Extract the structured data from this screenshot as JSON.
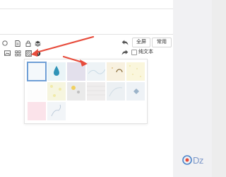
{
  "toolbar": {
    "buttons": {
      "fullscreen": "全屏",
      "common": "常用"
    },
    "plain_text_label": "纯文本",
    "icons": [
      "emoji-icon",
      "document-icon",
      "lock-icon",
      "layers-icon",
      "image-icon",
      "grid-icon",
      "pattern-icon",
      "globe-icon",
      "undo-icon",
      "redo-icon"
    ]
  },
  "background_picker": {
    "swatch_colors": [
      "#f4f8fb",
      "#eaf4f7",
      "#e3e0ec",
      "#eef3f6",
      "#f8f1e0",
      "#faf6dc",
      "#fdfdfd",
      "#f6f5df",
      "#eaeaea",
      "#efeded",
      "#ecf0f3",
      "#eef2f6",
      "#fbe3ea",
      "#f2f5f8"
    ],
    "selected_index": 0
  },
  "annotation": {
    "color": "#e74c3c"
  },
  "watermark": {
    "text": "Dz",
    "accent": "#4a83c9"
  }
}
